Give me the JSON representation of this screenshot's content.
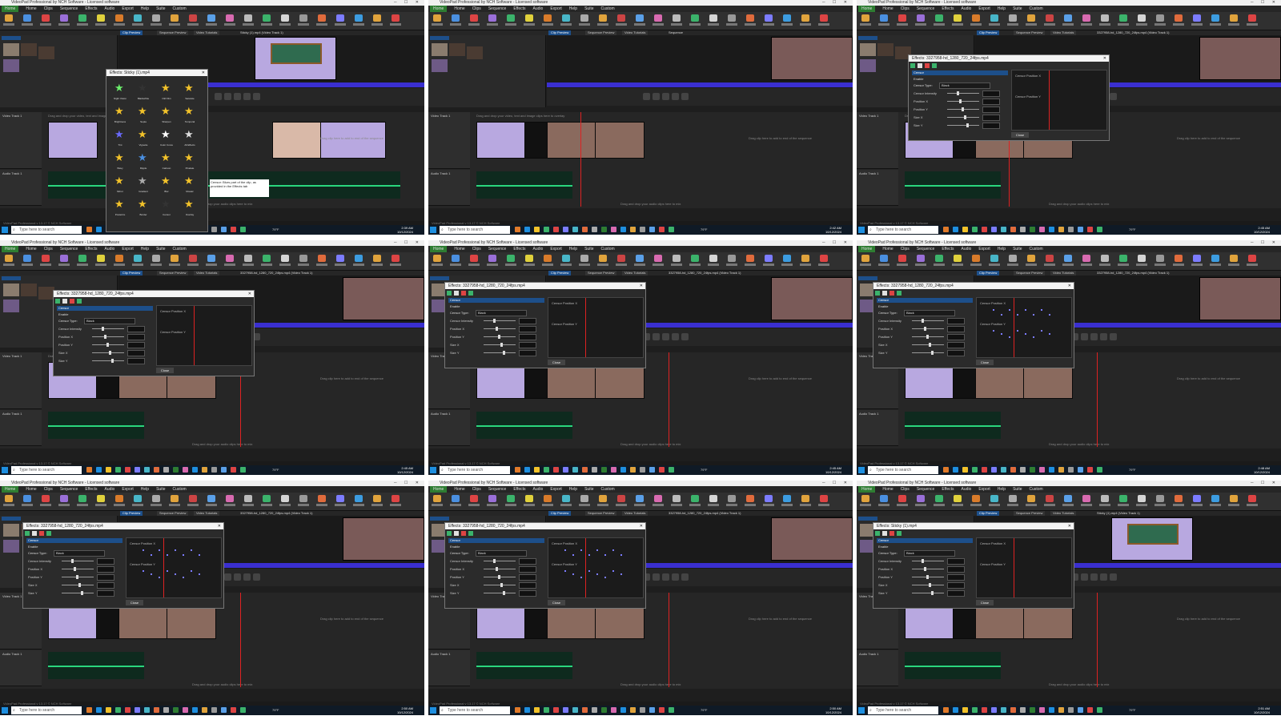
{
  "app": {
    "window_title": "VideoPad Professional by NCH Software - Licensed software",
    "menu": [
      "Home",
      "Home",
      "Clips",
      "Sequence",
      "Effects",
      "Audio",
      "Export",
      "Help",
      "Suite",
      "Custom"
    ],
    "view_tabs": [
      "Clip Preview",
      "Sequence Preview",
      "Video Tutorials"
    ],
    "status_text": "VideoPad Professional v 13.17 © NCH Software"
  },
  "timeline": {
    "drop_video_hint": "Drag clip here to add to end of the sequence",
    "drop_overlay_hint": "Drag and drop your video, text and image clips here to overlay",
    "drop_audio_hint": "Drag and drop your audio clips here to mix",
    "tracks": [
      "Video Track 1",
      "Audio Track 1"
    ]
  },
  "taskbar": {
    "search_placeholder": "Type here to search",
    "weather": "79°F"
  },
  "panels": [
    {
      "id": "p1",
      "clip_title": "Sticky (1).mp4 (Video Track 1)",
      "dialog": "effects",
      "dialog_title": "Effects: Sticky (1).mp4",
      "time": "2:39 AM",
      "date": "10/12/2024",
      "effects": [
        "Night Vision",
        "Blackwhite",
        "Old Film",
        "Saturate",
        "Brightness",
        "Sepia",
        "Sharpen",
        "Temporal",
        "Tint",
        "Vignette",
        "Color Curve",
        "All Effects",
        "Wavy",
        "Ripple",
        "Cartoon",
        "Pixelate",
        "Mirror",
        "Gradient",
        "Blur",
        "Mosaic",
        "Posterize",
        "Border",
        "Censor",
        "Overlay"
      ],
      "tooltip": "Censor: Blurs part of the clip, as provided in the Effects tab"
    },
    {
      "id": "p2",
      "clip_title": "Sequence",
      "dialog": "none",
      "time": "2:42 AM",
      "date": "10/12/2024"
    },
    {
      "id": "p3",
      "clip_title": "3327958-hd_1280_720_24fps.mp4 (Video Track 1)",
      "dialog": "censor",
      "dialog_title": "Effects: 3327958-hd_1280_720_24fps.mp4",
      "time": "2:45 AM",
      "date": "10/12/2024"
    },
    {
      "id": "p4",
      "clip_title": "3327958-hd_1280_720_24fps.mp4 (Video Track 1)",
      "dialog": "censor",
      "dialog_title": "Effects: 3327958-hd_1280_720_24fps.mp4",
      "time": "2:45 AM",
      "date": "10/12/2024"
    },
    {
      "id": "p5",
      "clip_title": "3327958-hd_1280_720_24fps.mp4 (Video Track 1)",
      "dialog": "censor",
      "dialog_title": "Effects: 3327958-hd_1280_720_24fps.mp4",
      "time": "2:45 AM",
      "date": "10/12/2024"
    },
    {
      "id": "p6",
      "clip_title": "3327958-hd_1280_720_24fps.mp4 (Video Track 1)",
      "dialog": "censor",
      "dialog_title": "Effects: 3327958-hd_1280_720_24fps.mp4",
      "time": "2:48 AM",
      "date": "10/12/2024"
    },
    {
      "id": "p7",
      "clip_title": "3327958-hd_1280_720_24fps.mp4 (Video Track 1)",
      "dialog": "censor",
      "dialog_title": "Effects: 3327958-hd_1280_720_24fps.mp4",
      "time": "2:50 AM",
      "date": "10/12/2024"
    },
    {
      "id": "p8",
      "clip_title": "3327958-hd_1280_720_24fps.mp4 (Video Track 1)",
      "dialog": "censor",
      "dialog_title": "Effects: 3327958-hd_1280_720_24fps.mp4",
      "time": "2:50 AM",
      "date": "10/12/2024"
    },
    {
      "id": "p9",
      "clip_title": "Sticky (1).mp4 (Video Track 1)",
      "dialog": "censor",
      "dialog_title": "Effects: Sticky (1).mp4",
      "time": "2:51 AM",
      "date": "10/12/2024"
    }
  ],
  "censor_dialog": {
    "section": "Censor",
    "enable": "Enable",
    "censor_type_label": "Censor Type:",
    "censor_type_value": "Black",
    "fields": [
      "Censor Intensity",
      "Position X",
      "Position Y",
      "Size X",
      "Size Y"
    ],
    "close_button": "Close",
    "graph_labels": [
      "Censor Position X",
      "Censor Position Y"
    ]
  },
  "colors": {
    "ui_dark": "#1e1e1e",
    "accent_green": "#2e7d32",
    "timeline_ruler": "#3a2fd0",
    "waveform": "#2ad67d",
    "playhead": "#d22222"
  }
}
